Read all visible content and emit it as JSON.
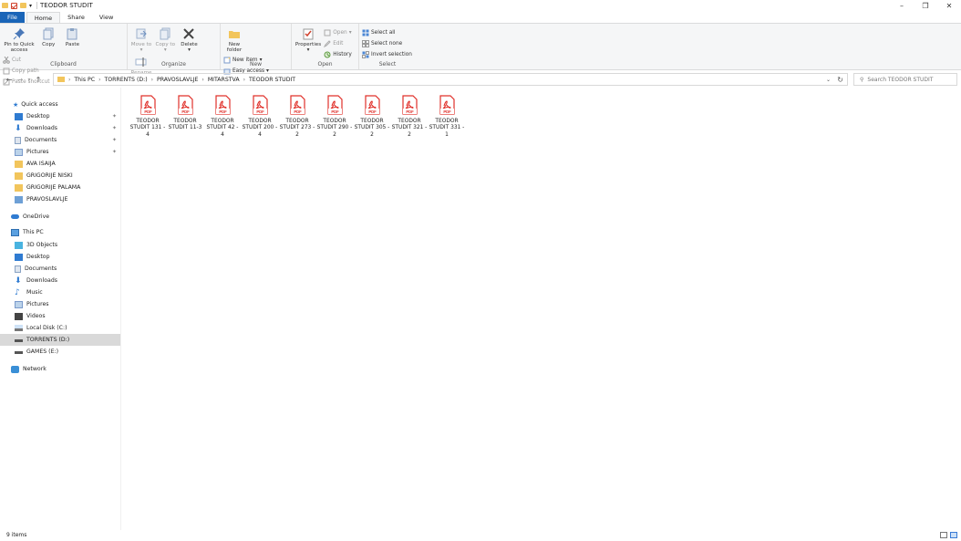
{
  "window": {
    "title": "TEODOR STUDIT",
    "controls": [
      "–",
      "❐",
      "✕"
    ]
  },
  "tabs": [
    {
      "label": "File"
    },
    {
      "label": "Home"
    },
    {
      "label": "Share"
    },
    {
      "label": "View"
    }
  ],
  "ribbon": {
    "clipboard": {
      "label": "Clipboard",
      "pin": "Pin to Quick access",
      "copy": "Copy",
      "paste": "Paste",
      "cut": "Cut",
      "copy_path": "Copy path",
      "paste_shortcut": "Paste shortcut"
    },
    "organize": {
      "label": "Organize",
      "move_to": "Move to",
      "copy_to": "Copy to",
      "delete": "Delete",
      "rename": "Rename"
    },
    "new": {
      "label": "New",
      "new_folder": "New folder",
      "new_item": "New item",
      "easy_access": "Easy access"
    },
    "open": {
      "label": "Open",
      "properties": "Properties",
      "open": "Open",
      "edit": "Edit",
      "history": "History"
    },
    "select": {
      "label": "Select",
      "select_all": "Select all",
      "select_none": "Select none",
      "invert": "Invert selection"
    }
  },
  "address": {
    "crumbs": [
      "This PC",
      "TORRENTS (D:)",
      "PRAVOSLAVLJE",
      "MITARSTVA",
      "TEODOR STUDIT"
    ]
  },
  "search": {
    "placeholder": "Search TEODOR STUDIT"
  },
  "nav": {
    "quick_access": "Quick access",
    "qa_items": [
      "Desktop",
      "Downloads",
      "Documents",
      "Pictures",
      "AVA ISAIJA",
      "GRIGORIJE NISKI",
      "GRIGORIJE PALAMA",
      "PRAVOSLAVLJE"
    ],
    "onedrive": "OneDrive",
    "this_pc": "This PC",
    "pc_items": [
      "3D Objects",
      "Desktop",
      "Documents",
      "Downloads",
      "Music",
      "Pictures",
      "Videos",
      "Local Disk (C:)",
      "TORRENTS (D:)",
      "GAMES (E:)"
    ],
    "network": "Network"
  },
  "files": [
    {
      "name": "TEODOR STUDIT 131 - 4"
    },
    {
      "name": "TEODOR STUDIT 11-3"
    },
    {
      "name": "TEODOR STUDIT 42 - 4"
    },
    {
      "name": "TEODOR STUDIT 200 - 4"
    },
    {
      "name": "TEODOR STUDIT 273 - 2"
    },
    {
      "name": "TEODOR STUDIT 290 - 2"
    },
    {
      "name": "TEODOR STUDIT 305 - 2"
    },
    {
      "name": "TEODOR STUDIT 321 - 2"
    },
    {
      "name": "TEODOR STUDIT 331 - 1"
    }
  ],
  "pdf_label": "PDF",
  "status": {
    "count": "9 items"
  },
  "colors": {
    "accent": "#1a65b8",
    "pdf_red": "#e0302a",
    "folder": "#f2c55c"
  }
}
